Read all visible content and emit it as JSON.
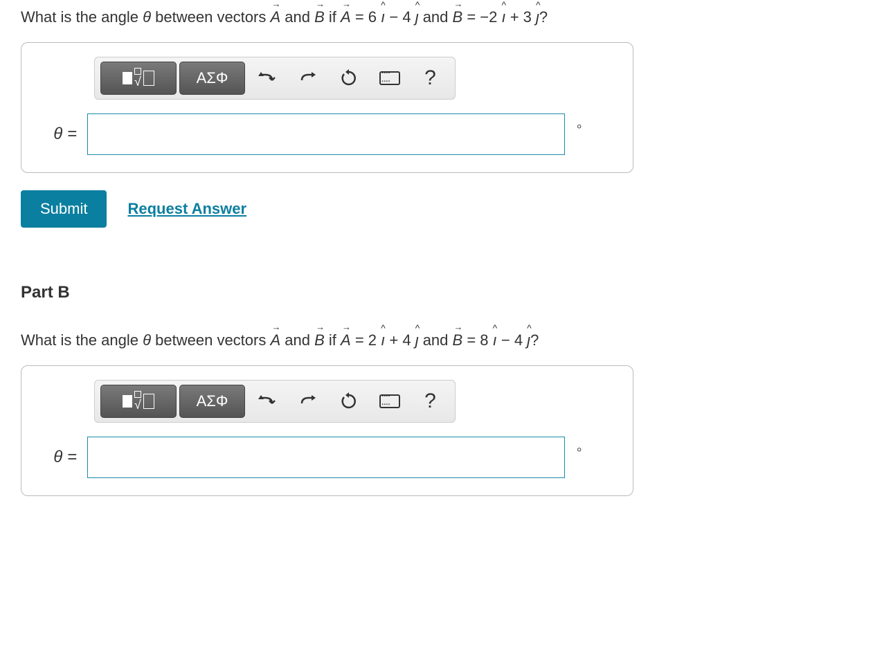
{
  "partA": {
    "question_prefix": "What is the angle ",
    "theta": "θ",
    "question_mid": " between vectors ",
    "vec_a": "A",
    "and_txt": " and ",
    "vec_b": "B",
    "if_txt": " if ",
    "eq_a": " = 6 ",
    "i_hat": "ı",
    "minus1": " − 4 ",
    "j_hat": "ȷ",
    "and2": " and ",
    "eq_b": " = −2 ",
    "plus1": " + 3 ",
    "qmark": "?",
    "theta_label": "θ =",
    "degree": "∘",
    "greek_label": "ΑΣΦ",
    "help_label": "?",
    "submit_label": "Submit",
    "request_label": "Request Answer"
  },
  "partB": {
    "header": "Part B",
    "question_prefix": "What is the angle ",
    "theta": "θ",
    "question_mid": " between vectors ",
    "vec_a": "A",
    "and_txt": " and ",
    "vec_b": "B",
    "if_txt": " if ",
    "eq_a": " = 2 ",
    "i_hat": "ı",
    "plus1": " + 4 ",
    "j_hat": "ȷ",
    "and2": " and ",
    "eq_b": " = 8 ",
    "minus1": " − 4 ",
    "qmark": "?",
    "theta_label": "θ =",
    "degree": "∘",
    "greek_label": "ΑΣΦ",
    "help_label": "?"
  }
}
